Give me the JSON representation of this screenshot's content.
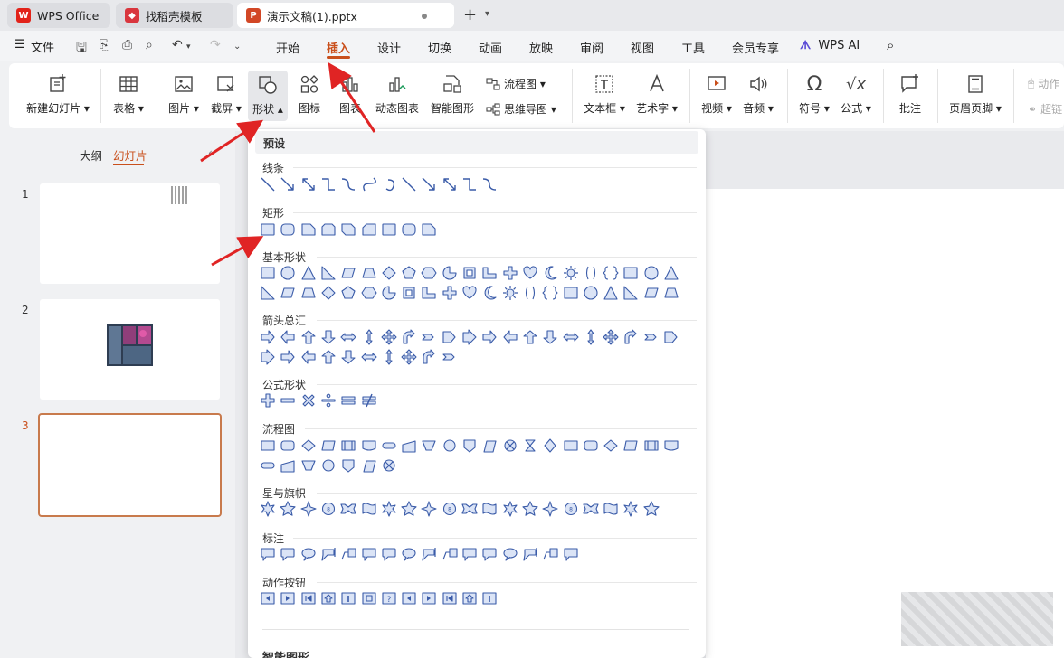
{
  "tabs": [
    {
      "label": "WPS Office",
      "icon": "wps-logo-icon"
    },
    {
      "label": "找稻壳模板",
      "icon": "docer-icon"
    },
    {
      "label": "演示文稿(1).pptx",
      "icon": "presentation-file-icon"
    }
  ],
  "menu": {
    "file_label": "文件",
    "tabs": [
      "开始",
      "插入",
      "设计",
      "切换",
      "动画",
      "放映",
      "审阅",
      "视图",
      "工具",
      "会员专享"
    ],
    "active_tab": "插入",
    "wps_ai_label": "WPS AI"
  },
  "ribbon": {
    "new_slide": "新建幻灯片",
    "table": "表格",
    "picture": "图片",
    "screenshot": "截屏",
    "shape": "形状",
    "icon": "图标",
    "chart": "图表",
    "dynamic_chart": "动态图表",
    "smart_graphic": "智能图形",
    "flowchart": "流程图",
    "mindmap": "思维导图",
    "textbox": "文本框",
    "wordart": "艺术字",
    "video": "视频",
    "audio": "音频",
    "symbol": "符号",
    "formula": "公式",
    "comment": "批注",
    "header_footer": "页眉页脚",
    "action": "动作",
    "hyperlink": "超链"
  },
  "left_panel": {
    "tabs": [
      "大纲",
      "幻灯片"
    ],
    "active_tab": "幻灯片",
    "slides": [
      "1",
      "2",
      "3"
    ],
    "active_slide": "3"
  },
  "shapes_dropdown": {
    "header": "预设",
    "sections": [
      {
        "title": "线条",
        "count": 12
      },
      {
        "title": "矩形",
        "count": 9
      },
      {
        "title": "基本形状",
        "count": 42
      },
      {
        "title": "箭头总汇",
        "count": 31
      },
      {
        "title": "公式形状",
        "count": 6
      },
      {
        "title": "流程图",
        "count": 28
      },
      {
        "title": "星与旗帜",
        "count": 20
      },
      {
        "title": "标注",
        "count": 16
      },
      {
        "title": "动作按钮",
        "count": 12
      }
    ],
    "bottom_section": "智能图形"
  },
  "colors": {
    "accent": "#c94f1b",
    "shape_stroke": "#3a5ba8",
    "shape_fill": "#dbe4f6",
    "arrow": "#e02424",
    "wps_red": "#e2231a"
  }
}
